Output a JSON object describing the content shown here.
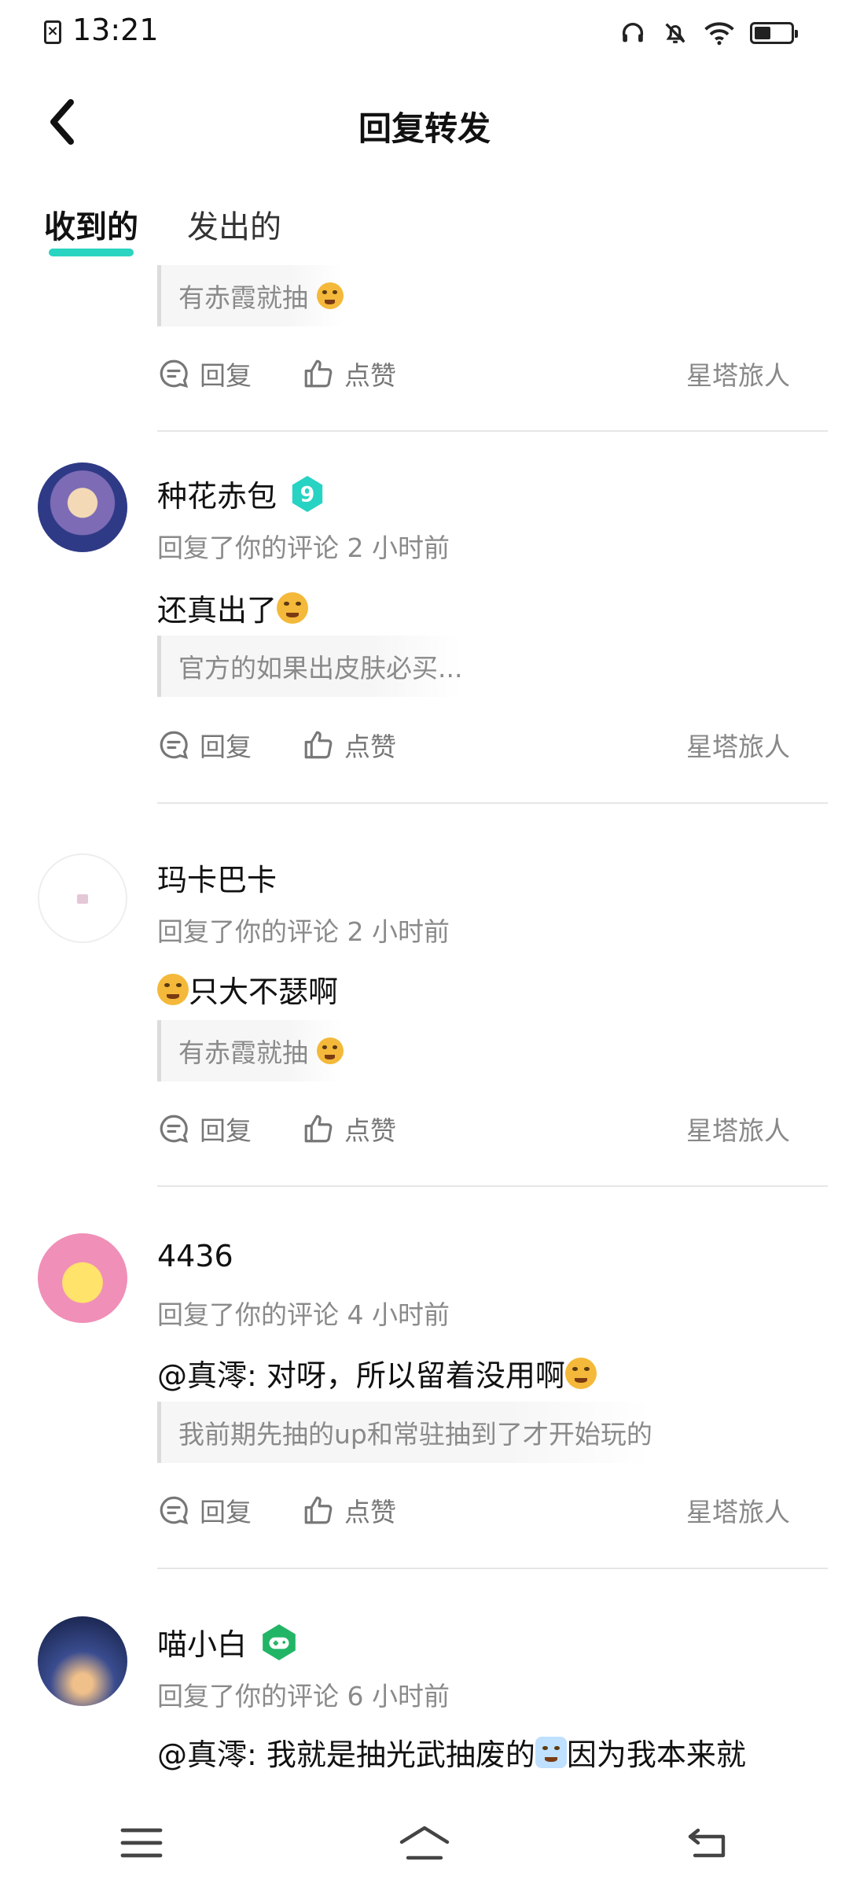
{
  "status_bar": {
    "time": "13:21",
    "battery_level": 0.45
  },
  "header": {
    "title": "回复转发"
  },
  "tabs": [
    {
      "label": "收到的",
      "active": true
    },
    {
      "label": "发出的",
      "active": false
    }
  ],
  "actions": {
    "reply_label": "回复",
    "like_label": "点赞"
  },
  "items": [
    {
      "quote": "有赤霞就抽",
      "game_tag": "星塔旅人"
    },
    {
      "username": "种花赤包",
      "badge": "9",
      "meta": "回复了你的评论 2 小时前",
      "content": "还真出了",
      "quote": "官方的如果出皮肤必买...",
      "game_tag": "星塔旅人"
    },
    {
      "username": "玛卡巴卡",
      "meta": "回复了你的评论 2 小时前",
      "content": "只大不瑟啊",
      "quote": "有赤霞就抽",
      "game_tag": "星塔旅人"
    },
    {
      "username": "4436",
      "meta": "回复了你的评论 4 小时前",
      "content": "@真澪: 对呀，所以留着没用啊",
      "quote": "我前期先抽的up和常驻抽到了才开始玩的",
      "game_tag": "星塔旅人"
    },
    {
      "username": "喵小白",
      "meta": "回复了你的评论 6 小时前",
      "content": "@真澪: 我就是抽光武抽废的",
      "content_suffix": " 因为我本来就"
    }
  ],
  "colors": {
    "accent": "#2bd4c0",
    "badge_teal": "#27d3c3",
    "badge_green": "#22b566"
  }
}
